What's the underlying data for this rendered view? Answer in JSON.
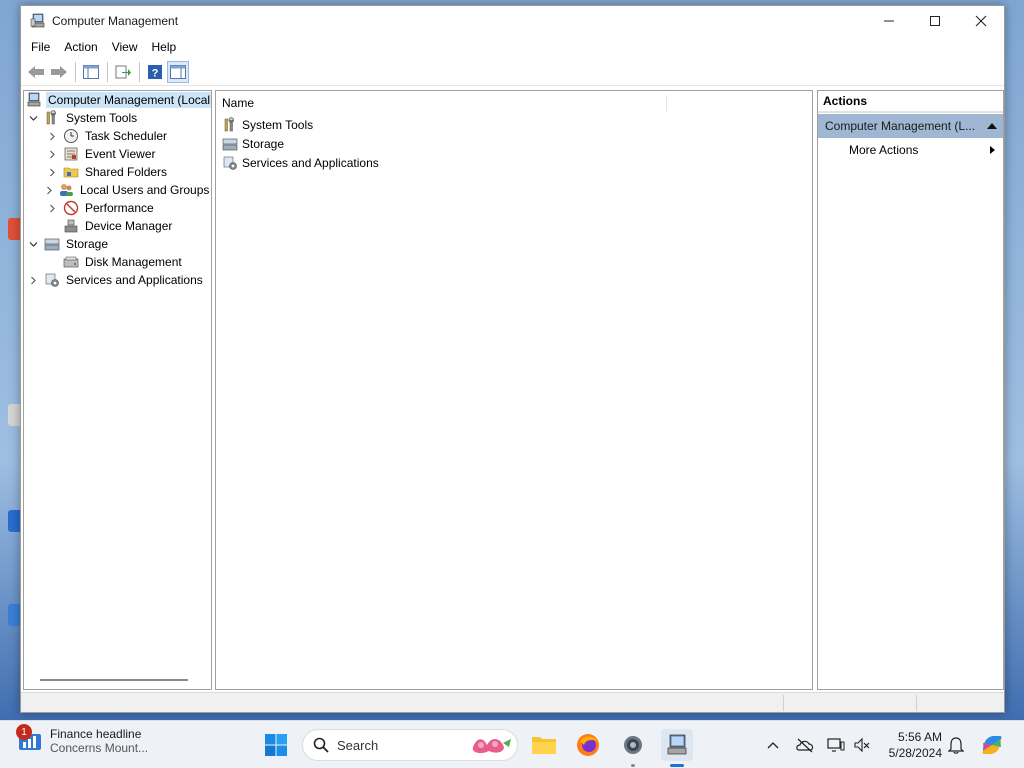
{
  "window": {
    "title": "Computer Management",
    "controls": {
      "minimize": "—",
      "maximize": "☐",
      "close": "✕"
    }
  },
  "menu": [
    "File",
    "Action",
    "View",
    "Help"
  ],
  "tree": {
    "root": "Computer Management (Local",
    "system_tools": "System Tools",
    "task_scheduler": "Task Scheduler",
    "event_viewer": "Event Viewer",
    "shared_folders": "Shared Folders",
    "local_users": "Local Users and Groups",
    "performance": "Performance",
    "device_manager": "Device Manager",
    "storage": "Storage",
    "disk_management": "Disk Management",
    "services": "Services and Applications"
  },
  "list": {
    "column_name": "Name",
    "items": [
      "System Tools",
      "Storage",
      "Services and Applications"
    ]
  },
  "actions": {
    "header": "Actions",
    "section": "Computer Management (L...",
    "more_actions": "More Actions"
  },
  "taskbar": {
    "widget_badge": "1",
    "widget_title": "Finance headline",
    "widget_subtitle": "Concerns Mount...",
    "search_placeholder": "Search",
    "time": "5:56 AM",
    "date": "5/28/2024"
  },
  "colors": {
    "selection": "#cce4f7",
    "actions_section": "#9fb7d2",
    "badge": "#c42b1c"
  }
}
